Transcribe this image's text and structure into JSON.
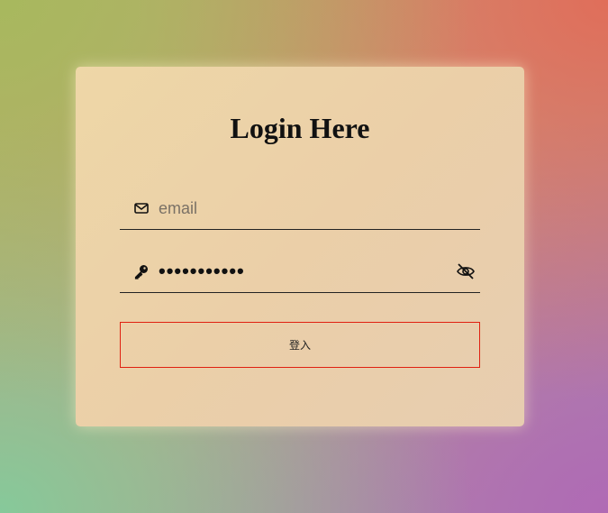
{
  "login": {
    "title": "Login Here",
    "email": {
      "placeholder": "email",
      "value": "",
      "icon": "envelope-icon"
    },
    "password": {
      "value": "•••••••••••",
      "icon": "key-icon",
      "toggle_icon": "eye-slash-icon"
    },
    "submit_label": "登入",
    "colors": {
      "submit_border": "#e02010",
      "field_underline": "#222222"
    }
  }
}
